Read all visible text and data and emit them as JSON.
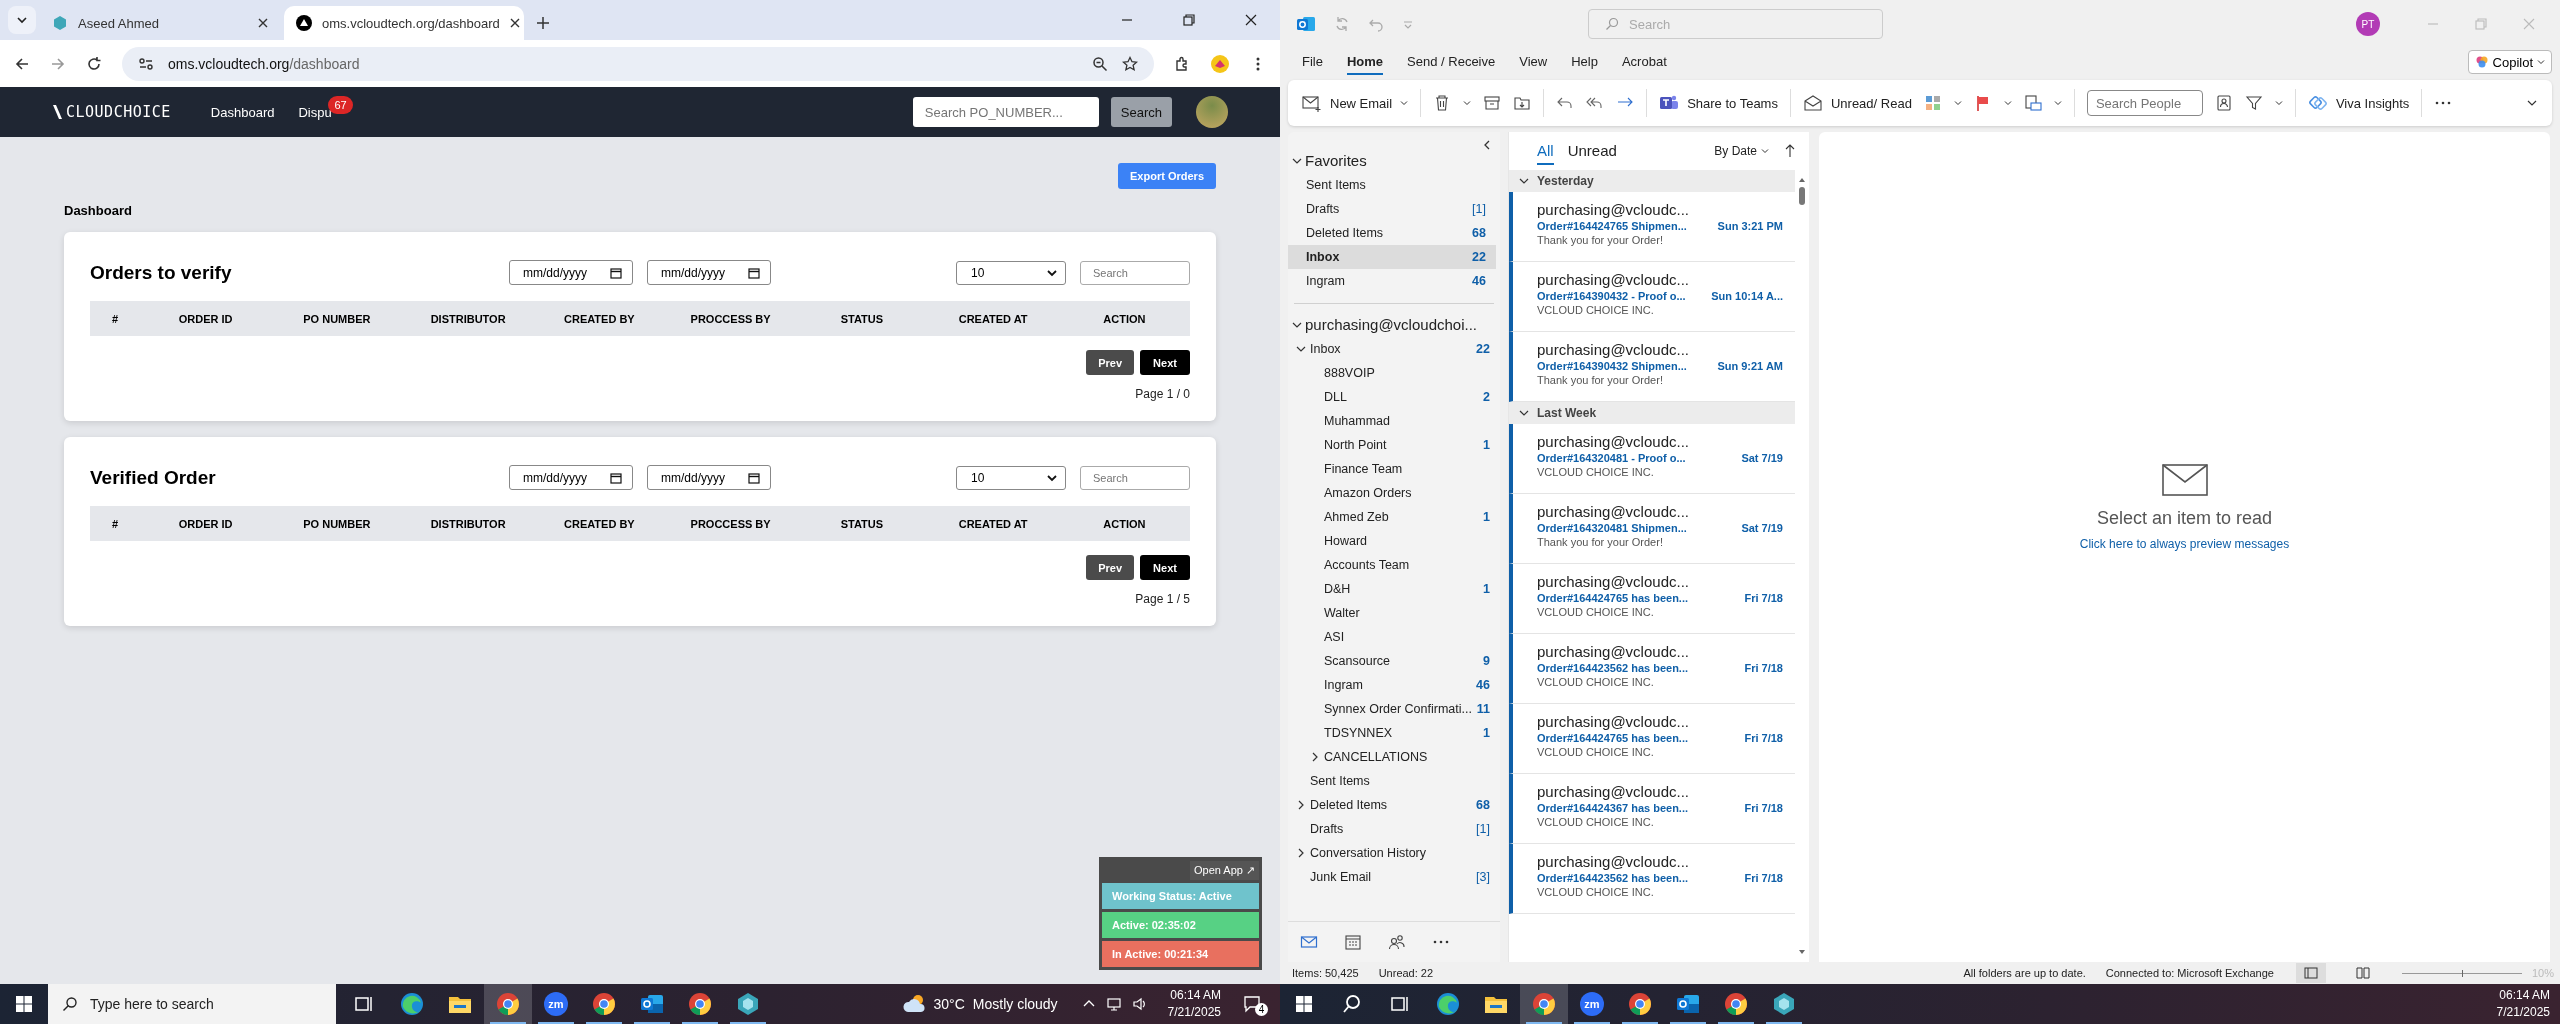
{
  "browser": {
    "tabs": [
      {
        "title": "Aseed Ahmed",
        "selected": false
      },
      {
        "title": "oms.vcloudtech.org/dashboard",
        "selected": true
      }
    ],
    "url_host": "oms.vcloudtech.org",
    "url_path": "/dashboard"
  },
  "web_app": {
    "logo": "CLOUDCHOICE",
    "nav": [
      {
        "label": "Dashboard"
      },
      {
        "label": "Dispu",
        "badge": "67"
      }
    ],
    "search_placeholder": "Search PO_NUMBER...",
    "search_button": "Search",
    "export_button": "Export Orders",
    "page_title": "Dashboard",
    "cards": [
      {
        "title": "Orders to verify",
        "date_fields": [
          "mm/dd/yyyy",
          "mm/dd/yyyy"
        ],
        "page_size": "10",
        "search_placeholder": "Search",
        "columns": [
          "#",
          "ORDER ID",
          "PO NUMBER",
          "DISTRIBUTOR",
          "CREATED BY",
          "PROCCESS BY",
          "STATUS",
          "CREATED AT",
          "ACTION"
        ],
        "prev": "Prev",
        "next": "Next",
        "page_info": "Page 1 / 0"
      },
      {
        "title": "Verified Order",
        "date_fields": [
          "mm/dd/yyyy",
          "mm/dd/yyyy"
        ],
        "page_size": "10",
        "search_placeholder": "Search",
        "columns": [
          "#",
          "ORDER ID",
          "PO NUMBER",
          "DISTRIBUTOR",
          "CREATED BY",
          "PROCCESS BY",
          "STATUS",
          "CREATED AT",
          "ACTION"
        ],
        "prev": "Prev",
        "next": "Next",
        "page_info": "Page 1 / 5"
      }
    ],
    "status_widget": {
      "open_app": "Open App ↗",
      "rows": [
        {
          "text": "Working Status: Active",
          "color": "#6fc3cc"
        },
        {
          "text": "Active: 02:35:02",
          "color": "#57d184"
        },
        {
          "text": "In Active: 00:21:34",
          "color": "#e8705f"
        }
      ]
    }
  },
  "left_taskbar": {
    "search_placeholder": "Type here to search",
    "apps": [
      {
        "kind": "taskview",
        "running": false,
        "active": false
      },
      {
        "kind": "edge",
        "running": false,
        "active": false
      },
      {
        "kind": "explorer",
        "running": false,
        "active": false
      },
      {
        "kind": "chrome",
        "running": true,
        "active": true
      },
      {
        "kind": "zoom",
        "label": "zm",
        "running": true,
        "active": false
      },
      {
        "kind": "chrome",
        "running": true,
        "active": false
      },
      {
        "kind": "outlook",
        "running": true,
        "active": false
      },
      {
        "kind": "chrome",
        "running": true,
        "active": false
      },
      {
        "kind": "app",
        "running": true,
        "active": false
      }
    ],
    "weather": "30°C",
    "weather_text": "Mostly cloudy",
    "time": "06:14 AM",
    "date": "7/21/2025",
    "notifications": "4"
  },
  "outlook": {
    "search_placeholder": "Search",
    "avatar": "PT",
    "menu": [
      {
        "label": "File",
        "selected": false
      },
      {
        "label": "Home",
        "selected": true
      },
      {
        "label": "Send / Receive",
        "selected": false
      },
      {
        "label": "View",
        "selected": false
      },
      {
        "label": "Help",
        "selected": false
      },
      {
        "label": "Acrobat",
        "selected": false
      }
    ],
    "copilot": "Copilot",
    "ribbon": {
      "new_email": "New Email",
      "share_teams": "Share to Teams",
      "unread_read": "Unread/ Read",
      "search_people": {
        "placeholder": "Search People"
      },
      "viva": "Viva Insights"
    },
    "favorites": {
      "title": "Favorites",
      "items": [
        {
          "name": "Sent Items",
          "selected": false
        },
        {
          "name": "Drafts",
          "count": "[1]",
          "selected": false
        },
        {
          "name": "Deleted Items",
          "count": "68",
          "selected": false
        },
        {
          "name": "Inbox",
          "count": "22",
          "selected": true
        },
        {
          "name": "Ingram",
          "count": "46",
          "selected": false
        }
      ]
    },
    "account": {
      "title": "purchasing@vcloudchoi...",
      "folders": [
        {
          "name": "Inbox",
          "count": "22",
          "expanded": true,
          "children": [
            {
              "name": "888VOIP"
            },
            {
              "name": "DLL",
              "count": "2"
            },
            {
              "name": "Muhammad"
            },
            {
              "name": "North Point",
              "count": "1"
            },
            {
              "name": "Finance Team"
            },
            {
              "name": "Amazon Orders"
            },
            {
              "name": "Ahmed Zeb",
              "count": "1"
            },
            {
              "name": "Howard"
            },
            {
              "name": "Accounts Team"
            },
            {
              "name": "D&H",
              "count": "1"
            },
            {
              "name": "Walter"
            },
            {
              "name": "ASI"
            },
            {
              "name": "Scansource",
              "count": "9"
            },
            {
              "name": "Ingram",
              "count": "46"
            },
            {
              "name": "Synnex Order Confirmati...",
              "count": "11"
            },
            {
              "name": "TDSYNNEX",
              "count": "1"
            },
            {
              "name": "CANCELLATIONS",
              "expanded": false
            }
          ]
        },
        {
          "name": "Sent Items"
        },
        {
          "name": "Deleted Items",
          "count": "68",
          "expanded": false
        },
        {
          "name": "Drafts",
          "count": "[1]"
        },
        {
          "name": "Conversation History",
          "expanded": false
        },
        {
          "name": "Junk Email",
          "count": "[3]"
        }
      ]
    },
    "filters": [
      {
        "label": "All",
        "selected": true
      },
      {
        "label": "Unread",
        "selected": false
      }
    ],
    "sort": "By Date",
    "groups": [
      {
        "label": "Yesterday",
        "messages": [
          {
            "sender": "purchasing@vcloudc...",
            "subject": "Order#164424765 Shipmen...",
            "time": "Sun 3:21 PM",
            "preview": "Thank you for your Order!"
          },
          {
            "sender": "purchasing@vcloudc...",
            "subject": "Order#164390432 - Proof o...",
            "time": "Sun 10:14 A...",
            "preview": "VCLOUD CHOICE INC."
          },
          {
            "sender": "purchasing@vcloudc...",
            "subject": "Order#164390432 Shipmen...",
            "time": "Sun 9:21 AM",
            "preview": "Thank you for your Order!"
          }
        ]
      },
      {
        "label": "Last Week",
        "messages": [
          {
            "sender": "purchasing@vcloudc...",
            "subject": "Order#164320481 - Proof o...",
            "time": "Sat 7/19",
            "preview": "VCLOUD CHOICE INC."
          },
          {
            "sender": "purchasing@vcloudc...",
            "subject": "Order#164320481 Shipmen...",
            "time": "Sat 7/19",
            "preview": "Thank you for your Order!"
          },
          {
            "sender": "purchasing@vcloudc...",
            "subject": "Order#164424765 has been...",
            "time": "Fri 7/18",
            "preview": "VCLOUD CHOICE INC."
          },
          {
            "sender": "purchasing@vcloudc...",
            "subject": "Order#164423562 has been...",
            "time": "Fri 7/18",
            "preview": "VCLOUD CHOICE INC."
          },
          {
            "sender": "purchasing@vcloudc...",
            "subject": "Order#164424765 has been...",
            "time": "Fri 7/18",
            "preview": "VCLOUD CHOICE INC."
          },
          {
            "sender": "purchasing@vcloudc...",
            "subject": "Order#164424367 has been...",
            "time": "Fri 7/18",
            "preview": "VCLOUD CHOICE INC."
          },
          {
            "sender": "purchasing@vcloudc...",
            "subject": "Order#164423562 has been...",
            "time": "Fri 7/18",
            "preview": "VCLOUD CHOICE INC."
          }
        ]
      }
    ],
    "reading_pane": {
      "message": "Select an item to read",
      "link": "Click here to always preview messages"
    },
    "status_bar": {
      "items": "Items: 50,425",
      "unread": "Unread: 22",
      "sync": "All folders are up to date.",
      "connection": "Connected to: Microsoft Exchange",
      "zoom": "10%",
      "zoom_slider": {
        "level": 0.5
      }
    }
  },
  "right_taskbar": {
    "apps": [
      {
        "kind": "search",
        "running": false,
        "active": false
      },
      {
        "kind": "taskview",
        "running": false,
        "active": false
      },
      {
        "kind": "edge",
        "running": false,
        "active": false
      },
      {
        "kind": "explorer",
        "running": false,
        "active": false
      },
      {
        "kind": "chrome",
        "running": true,
        "active": true
      },
      {
        "kind": "zoom",
        "label": "zm",
        "running": true,
        "active": false
      },
      {
        "kind": "chrome",
        "running": true,
        "active": false
      },
      {
        "kind": "outlook",
        "running": true,
        "active": false
      },
      {
        "kind": "chrome",
        "running": true,
        "active": false
      },
      {
        "kind": "app",
        "running": true,
        "active": false
      }
    ],
    "time": "06:14 AM",
    "date": "7/21/2025"
  }
}
